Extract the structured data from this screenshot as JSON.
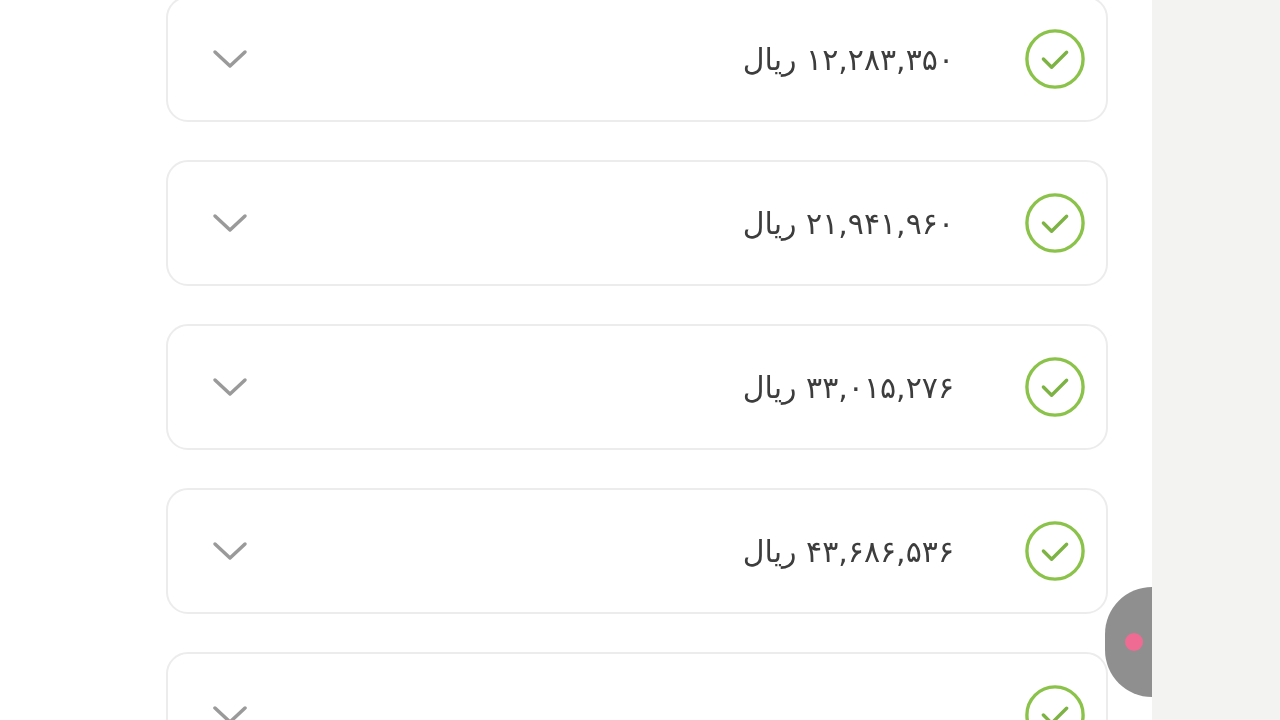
{
  "payments": [
    {
      "amount": "۱۲,۲۸۳,۳۵۰ ریال",
      "checked": true
    },
    {
      "amount": "۲۱,۹۴۱,۹۶۰ ریال",
      "checked": true
    },
    {
      "amount": "۳۳,۰۱۵,۲۷۶ ریال",
      "checked": true
    },
    {
      "amount": "۴۳,۶۸۶,۵۳۶ ریال",
      "checked": true
    },
    {
      "checked": true
    }
  ]
}
